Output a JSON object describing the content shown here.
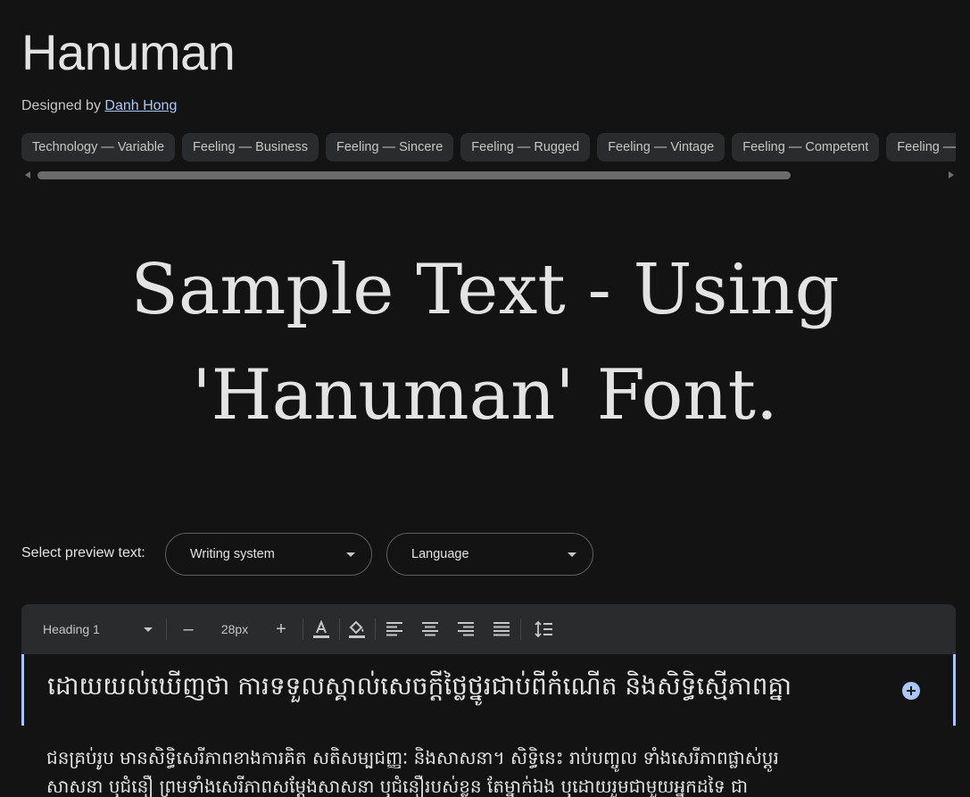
{
  "font": {
    "name": "Hanuman",
    "designed_by_prefix": "Designed by",
    "designer": "Danh Hong"
  },
  "tags": [
    "Technology — Variable",
    "Feeling — Business",
    "Feeling — Sincere",
    "Feeling — Rugged",
    "Feeling — Vintage",
    "Feeling — Competent",
    "Feeling — Calm"
  ],
  "sample": {
    "line1": "Sample Text - Using",
    "line2": "'Hanuman' Font."
  },
  "preview": {
    "label": "Select preview text:",
    "writing_system": "Writing system",
    "language": "Language"
  },
  "toolbar": {
    "style": "Heading 1",
    "decrease": "–",
    "size": "28px",
    "increase": "+"
  },
  "editor": {
    "heading": "ដោយយល់ឃើញថា ការទទួលស្គាល់សេចក្ដីថ្លៃថ្នូរជាប់ពីកំណើត និងសិទ្ធិស្មើភាពគ្នា",
    "body_line1": "ជនគ្រប់រូប មានសិទ្ធិសេរីភាពខាងការគិត សតិសម្បជញ្ញៈ និងសាសនា។ សិទ្ធិនេះ រាប់បញ្ចូល ទាំងសេរីភាពផ្លាស់ប្ដូរ",
    "body_line2": "សាសនា ឬជំនឿ ព្រមទាំងសេរីភាពសម្ដែងសាសនា ឬជំនឿរបស់ខ្លួន តែម្នាក់ឯង ឬដោយរួមជាមួយអ្នកដទៃ ជា"
  },
  "colors": {
    "background": "#131314",
    "accent": "#a8c7fa",
    "chip": "#2a2b2c"
  }
}
